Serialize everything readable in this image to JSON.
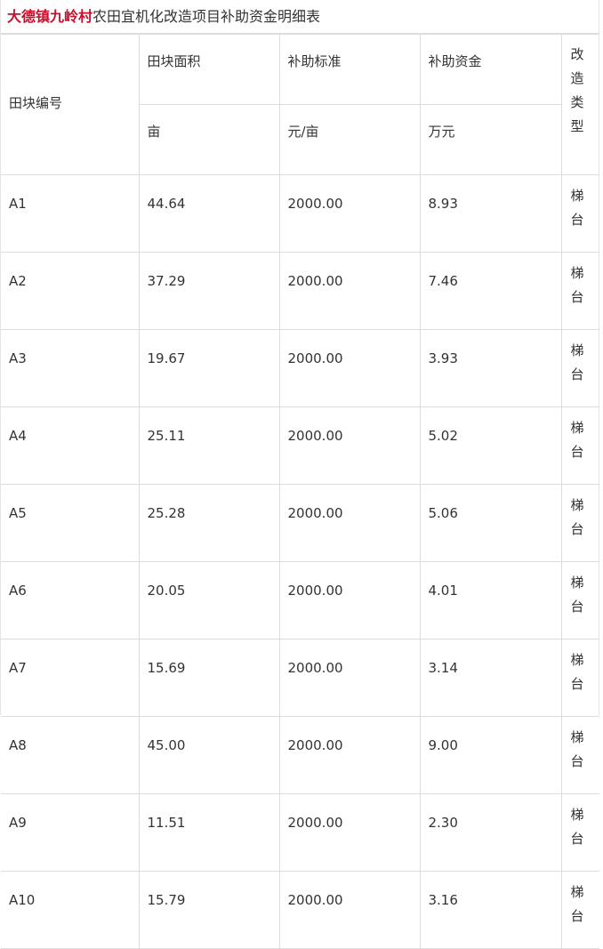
{
  "caption": {
    "highlight": "大德镇九岭村",
    "rest": "农田宜机化改造项目补助资金明细表"
  },
  "header": {
    "plot_id": "田块编号",
    "area": "田块面积",
    "standard": "补助标准",
    "funds": "补助资金",
    "type_chars": [
      "改",
      "造",
      "类",
      "型"
    ],
    "area_unit": "亩",
    "standard_unit": "元/亩",
    "funds_unit": "万元"
  },
  "rows": [
    {
      "id": "A1",
      "area": "44.64",
      "standard": "2000.00",
      "funds": "8.93",
      "type_chars": [
        "梯",
        "台"
      ]
    },
    {
      "id": "A2",
      "area": "37.29",
      "standard": "2000.00",
      "funds": "7.46",
      "type_chars": [
        "梯",
        "台"
      ]
    },
    {
      "id": "A3",
      "area": "19.67",
      "standard": "2000.00",
      "funds": "3.93",
      "type_chars": [
        "梯",
        "台"
      ]
    },
    {
      "id": "A4",
      "area": "25.11",
      "standard": "2000.00",
      "funds": "5.02",
      "type_chars": [
        "梯",
        "台"
      ]
    },
    {
      "id": "A5",
      "area": "25.28",
      "standard": "2000.00",
      "funds": "5.06",
      "type_chars": [
        "梯",
        "台"
      ]
    },
    {
      "id": "A6",
      "area": "20.05",
      "standard": "2000.00",
      "funds": "4.01",
      "type_chars": [
        "梯",
        "台"
      ]
    },
    {
      "id": "A7",
      "area": "15.69",
      "standard": "2000.00",
      "funds": "3.14",
      "type_chars": [
        "梯",
        "台"
      ]
    },
    {
      "id": "A8",
      "area": "45.00",
      "standard": "2000.00",
      "funds": "9.00",
      "type_chars": [
        "梯",
        "台"
      ]
    },
    {
      "id": "A9",
      "area": "11.51",
      "standard": "2000.00",
      "funds": "2.30",
      "type_chars": [
        "梯",
        "台"
      ]
    },
    {
      "id": "A10",
      "area": "15.79",
      "standard": "2000.00",
      "funds": "3.16",
      "type_chars": [
        "梯",
        "台"
      ]
    }
  ],
  "colors": {
    "highlight": "#c8102e",
    "text": "#333333",
    "border": "#dcdcdc"
  }
}
